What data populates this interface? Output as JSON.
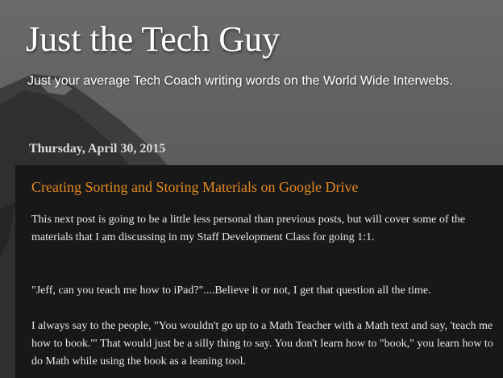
{
  "header": {
    "title": "Just the Tech Guy",
    "description": "Just your average Tech Coach writing words on the World Wide Interwebs."
  },
  "post": {
    "date": "Thursday, April 30, 2015",
    "title": "Creating Sorting and Storing Materials on Google Drive",
    "paragraphs": [
      "This next post is going to be a little less personal than previous posts, but will cover some of the materials that I am discussing in my Staff Development Class for going 1:1.",
      "\"Jeff, can you teach me how to iPad?\"....Believe it or not, I get that question all the time.",
      "I always say to the people, \"You wouldn't go up to a Math Teacher with a Math text and say, 'teach me how to book.'\" That would just be a silly thing to say. You don't learn how to \"book,\" you learn how to do Math while using the book as a leaning tool."
    ]
  },
  "colors": {
    "title_text": "#ffffff",
    "post_title": "#e58a1f",
    "post_panel": "#181818",
    "post_text": "#e8e8e8",
    "date_text": "#dcdcdc"
  }
}
